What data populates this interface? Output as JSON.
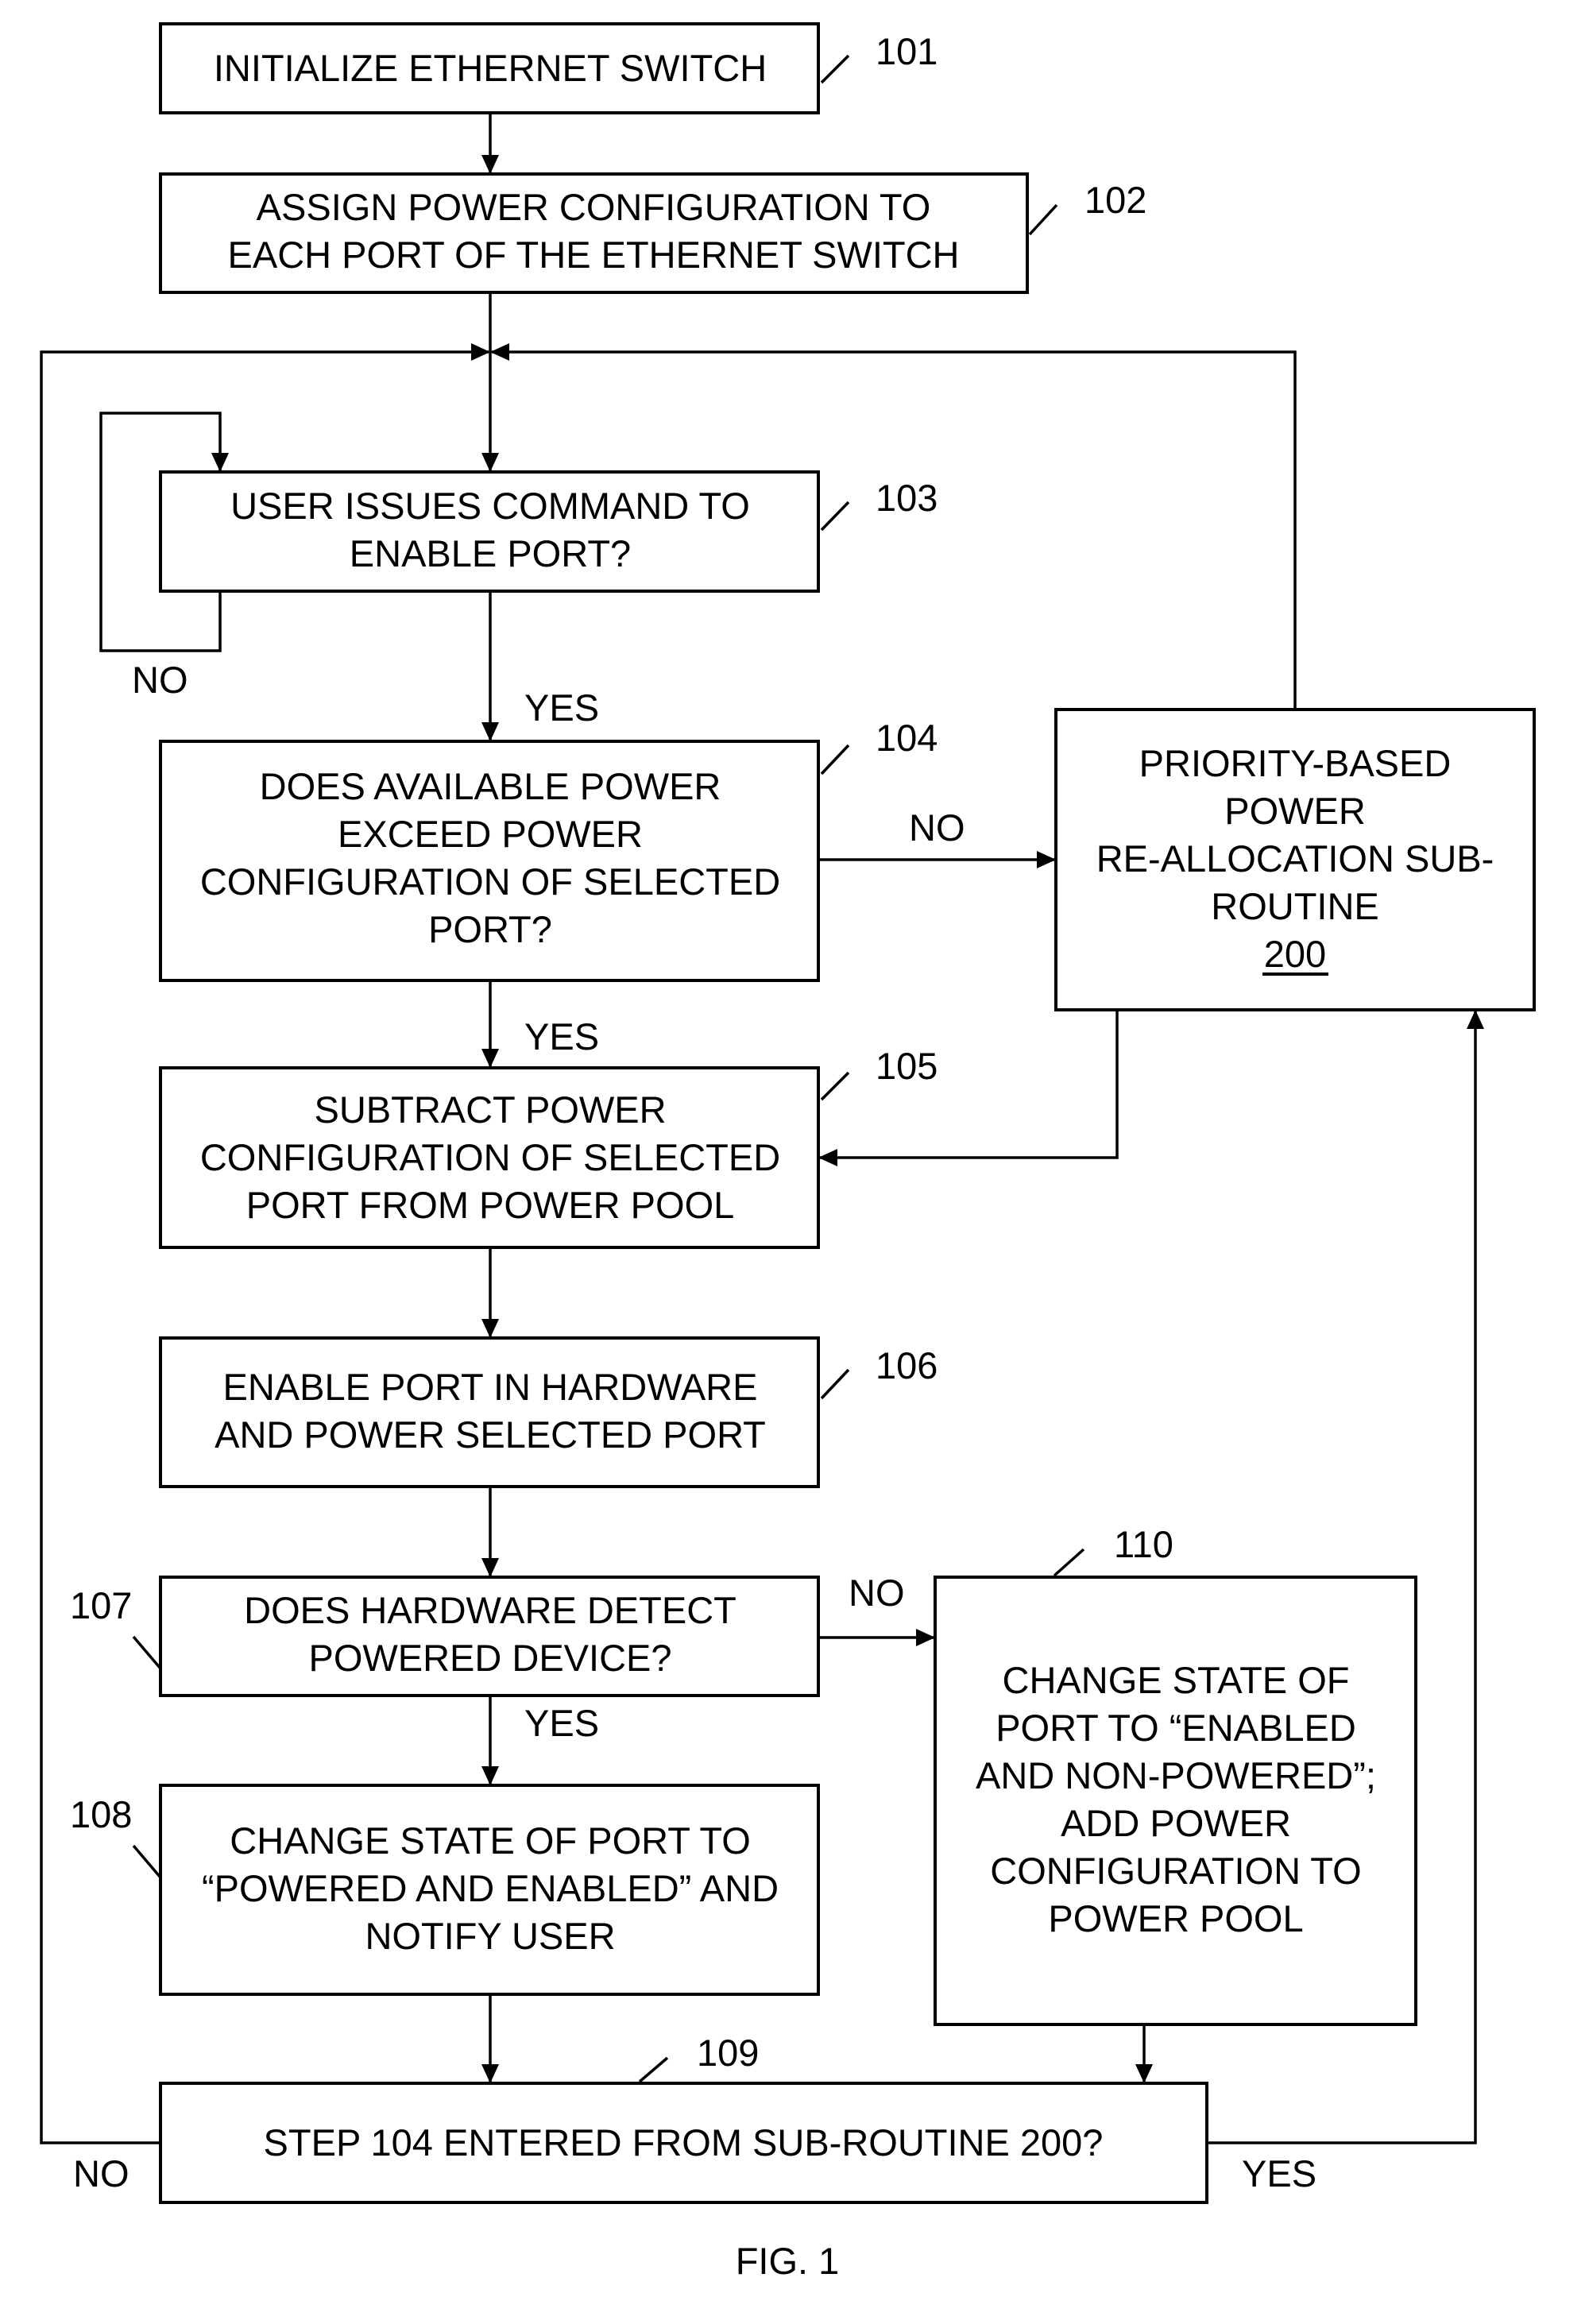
{
  "figure": {
    "caption": "FIG. 1",
    "colors": {
      "stroke": "#000000",
      "background": "#ffffff"
    }
  },
  "steps": {
    "s101": {
      "ref": "101",
      "lines": [
        "INITIALIZE ETHERNET SWITCH"
      ]
    },
    "s102": {
      "ref": "102",
      "lines": [
        "ASSIGN POWER CONFIGURATION TO",
        "EACH PORT OF THE ETHERNET SWITCH"
      ]
    },
    "s103": {
      "ref": "103",
      "lines": [
        "USER ISSUES COMMAND TO",
        "ENABLE PORT?"
      ]
    },
    "s104": {
      "ref": "104",
      "lines": [
        "DOES AVAILABLE POWER",
        "EXCEED POWER",
        "CONFIGURATION OF SELECTED",
        "PORT?"
      ]
    },
    "s105": {
      "ref": "105",
      "lines": [
        "SUBTRACT POWER",
        "CONFIGURATION OF SELECTED",
        "PORT FROM POWER POOL"
      ]
    },
    "s106": {
      "ref": "106",
      "lines": [
        "ENABLE PORT IN HARDWARE",
        "AND POWER SELECTED PORT"
      ]
    },
    "s107": {
      "ref": "107",
      "lines": [
        "DOES HARDWARE DETECT",
        "POWERED DEVICE?"
      ]
    },
    "s108": {
      "ref": "108",
      "lines": [
        "CHANGE STATE OF PORT TO",
        "“POWERED AND ENABLED” AND",
        "NOTIFY USER"
      ]
    },
    "s109": {
      "ref": "109",
      "lines": [
        "STEP 104 ENTERED FROM SUB-ROUTINE 200?"
      ]
    },
    "s110": {
      "ref": "110",
      "lines": [
        "CHANGE STATE OF",
        "PORT TO “ENABLED",
        "AND NON-POWERED”;",
        "ADD POWER",
        "CONFIGURATION TO",
        "POWER POOL"
      ]
    },
    "s200": {
      "ref": "200",
      "lines": [
        "PRIORITY-BASED",
        "POWER",
        "RE-ALLOCATION SUB-",
        "ROUTINE"
      ]
    }
  },
  "edge_labels": {
    "s103_no": "NO",
    "s103_yes": "YES",
    "s104_no": "NO",
    "s104_yes": "YES",
    "s107_no": "NO",
    "s107_yes": "YES",
    "s109_no": "NO",
    "s109_yes": "YES"
  }
}
